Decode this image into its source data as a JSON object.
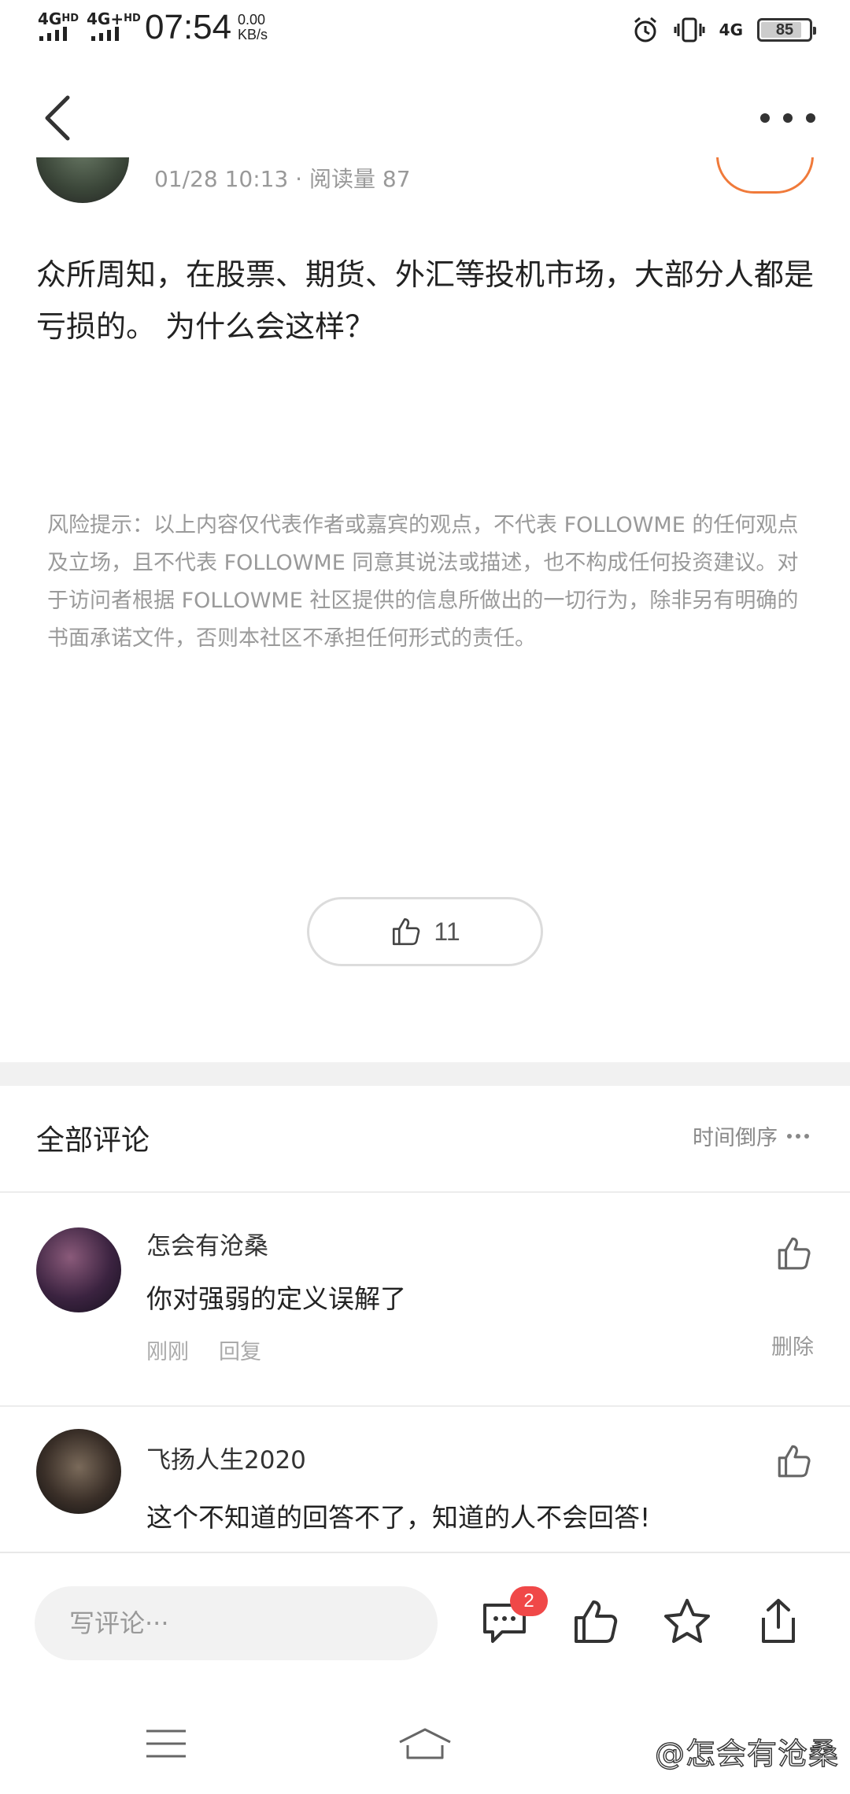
{
  "status_bar": {
    "network1": "4G",
    "network1_sup": "HD",
    "network2": "4G+",
    "network2_sup": "HD",
    "time": "07:54",
    "speed_value": "0.00",
    "speed_unit": "KB/s",
    "network_right": "4G",
    "battery": "85",
    "battery_level": 0.85
  },
  "author": {
    "meta": "01/28 10:13 · 阅读量 87"
  },
  "post": {
    "text": "众所周知，在股票、期货、外汇等投机市场，大部分人都是亏损的。 为什么会这样？",
    "disclaimer": "风险提示：以上内容仅代表作者或嘉宾的观点，不代表 FOLLOWME 的任何观点及立场，且不代表 FOLLOWME 同意其说法或描述，也不构成任何投资建议。对于访问者根据 FOLLOWME 社区提供的信息所做出的一切行为，除非另有明确的书面承诺文件，否则本社区不承担任何形式的责任。",
    "like_count": "11"
  },
  "comments_section": {
    "title": "全部评论",
    "sort_label": "时间倒序"
  },
  "comments": [
    {
      "name": "怎会有沧桑",
      "text": "你对强弱的定义误解了",
      "time": "刚刚",
      "reply": "回复",
      "delete": "删除"
    },
    {
      "name": "飞扬人生2020",
      "text": "这个不知道的回答不了，知道的人不会回答!"
    }
  ],
  "action_bar": {
    "input_placeholder": "写评论···",
    "comment_badge": "2"
  },
  "watermark": "@怎会有沧桑",
  "colors": {
    "accent": "#f07a3a",
    "badge": "#f04848"
  }
}
